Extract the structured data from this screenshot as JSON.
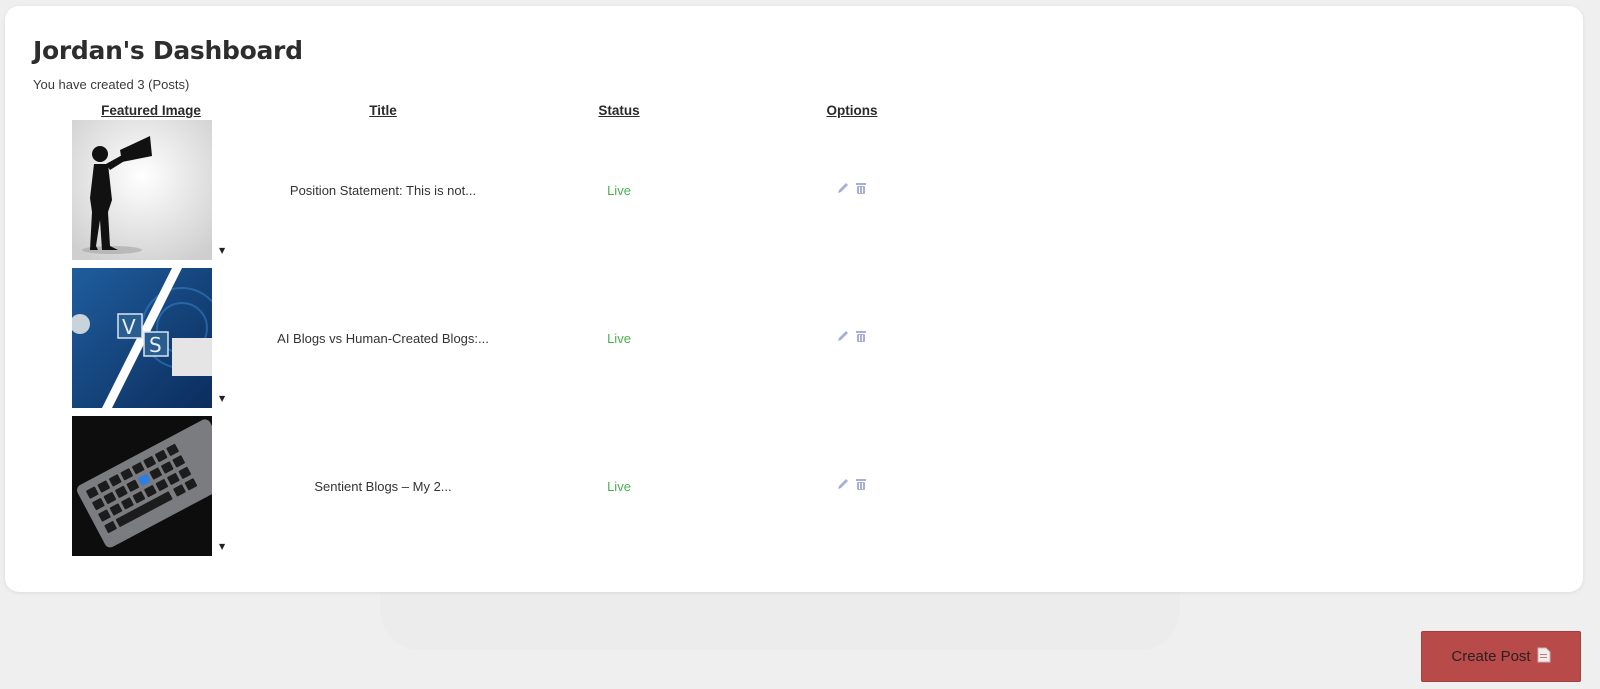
{
  "dashboard": {
    "title": "Jordan's Dashboard",
    "subtitle": "You have created 3 (Posts)"
  },
  "table": {
    "headers": {
      "featured_image": "Featured Image",
      "title": "Title",
      "status": "Status",
      "options": "Options"
    },
    "rows": [
      {
        "title": "Position Statement: This is not...",
        "status": "Live",
        "image_icon": "megaphone-silhouette-image"
      },
      {
        "title": "AI Blogs vs Human-Created Blogs:...",
        "status": "Live",
        "image_icon": "robot-vs-human-image"
      },
      {
        "title": "Sentient Blogs – My 2...",
        "status": "Live",
        "image_icon": "keyboard-image"
      }
    ]
  },
  "actions": {
    "create_post_label": "Create Post"
  },
  "colors": {
    "status_live": "#4caf50",
    "create_button": "#b94a4a",
    "option_icons": "#a8afd6"
  }
}
